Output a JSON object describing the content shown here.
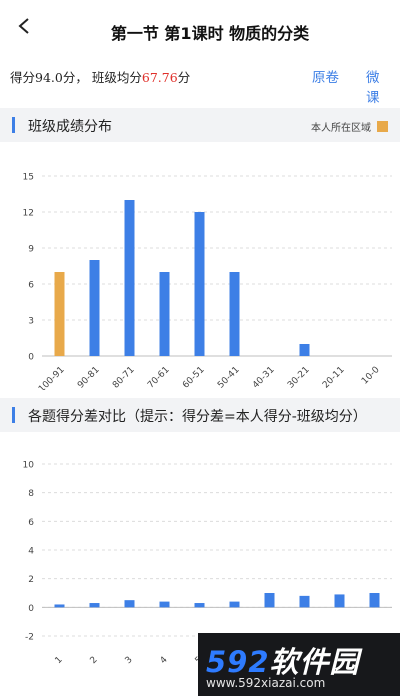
{
  "header": {
    "title": "第一节 第1课时 物质的分类",
    "back": "<"
  },
  "score": {
    "label": "得分",
    "value": "94.0",
    "unit": "分",
    "sep": "，",
    "avg_label": "班级均分",
    "avg_value": "67.76",
    "avg_unit": "分"
  },
  "links": {
    "original": "原卷",
    "micro": "微课"
  },
  "section1": {
    "title": "班级成绩分布",
    "legend": "本人所在区域",
    "legend_color": "#e8a94a"
  },
  "section2": {
    "title": "各题得分差对比（提示：得分差=本人得分-班级均分）"
  },
  "colors": {
    "bar": "#3d7fe6",
    "highlight": "#e8a94a",
    "accent_text": "#e0302a"
  },
  "chart_data": [
    {
      "type": "bar",
      "categories": [
        "100-91",
        "90-81",
        "80-71",
        "70-61",
        "60-51",
        "50-41",
        "40-31",
        "30-21",
        "20-11",
        "10-0"
      ],
      "values": [
        7,
        8,
        13,
        7,
        12,
        7,
        0,
        1,
        0,
        0
      ],
      "highlight_index": 0,
      "ylim": [
        0,
        15
      ],
      "yticks": [
        0,
        3,
        6,
        9,
        12,
        15
      ],
      "grid": true,
      "legend": "top-right"
    },
    {
      "type": "bar",
      "categories": [
        "1",
        "2",
        "3",
        "4",
        "5",
        "6",
        "7",
        "8",
        "9",
        "10"
      ],
      "values": [
        0.2,
        0.3,
        0.5,
        0.4,
        0.3,
        0.4,
        1.0,
        0.8,
        0.9,
        1.0
      ],
      "ylim": [
        -2,
        10
      ],
      "yticks": [
        -2,
        0,
        2,
        4,
        6,
        8,
        10
      ],
      "grid": true
    }
  ],
  "watermark": {
    "num": "592",
    "text": "软件园",
    "url": "www.592xiazai.com"
  }
}
